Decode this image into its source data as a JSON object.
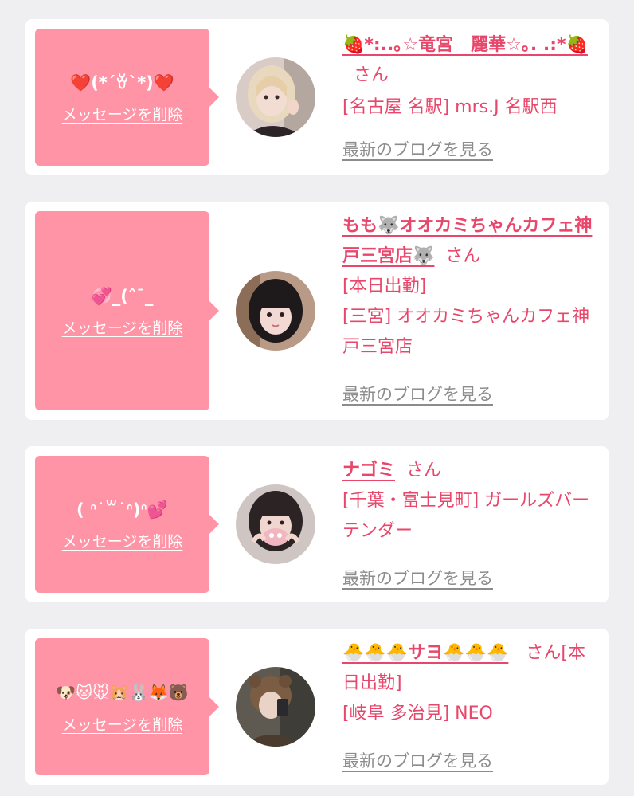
{
  "colors": {
    "background": "#efeff2",
    "card": "#ffffff",
    "message_box": "#fe94a5",
    "accent_text": "#e8466a",
    "muted_link": "#8c8c8c"
  },
  "cards": [
    {
      "message": "❤️(*´ꈊ`*)❤️",
      "delete_label": "メッセージを削除",
      "name": "🍓*:..｡☆竜宮　麗華☆｡. .:*🍓",
      "honorific": "さん",
      "details": [
        "[名古屋 名駅] mrs.J 名駅西"
      ],
      "blog_label": "最新のブログを見る",
      "avatar_icon": "profile-photo-blonde-girl"
    },
    {
      "message": "💞_(ˆ¯_",
      "delete_label": "メッセージを削除",
      "name": "もも🐺オオカミちゃんカフェ神戸三宮店🐺",
      "honorific": "さん",
      "details": [
        "[本日出勤]",
        "[三宮] オオカミちゃんカフェ神戸三宮店"
      ],
      "blog_label": "最新のブログを見る",
      "avatar_icon": "profile-photo-dark-hair-girl"
    },
    {
      "message": "( ᐢ˙꒳˙ᐢ)ᐢ💕",
      "delete_label": "メッセージを削除",
      "name": "ナゴミ",
      "honorific": "さん",
      "details": [
        "[千葉・富士見町] ガールズバー テンダー"
      ],
      "blog_label": "最新のブログを見る",
      "avatar_icon": "profile-photo-mask-girl"
    },
    {
      "message": "🐶🐱🐭🐹🐰🦊🐻",
      "delete_label": "メッセージを削除",
      "name": "🐣🐣🐣サヨ🐣🐣🐣",
      "honorific": "さん",
      "details": [
        "[本日出勤]",
        "[岐阜 多治見] NEO"
      ],
      "blog_label": "最新のブログを見る",
      "avatar_icon": "profile-photo-bear-hat-girl"
    }
  ]
}
